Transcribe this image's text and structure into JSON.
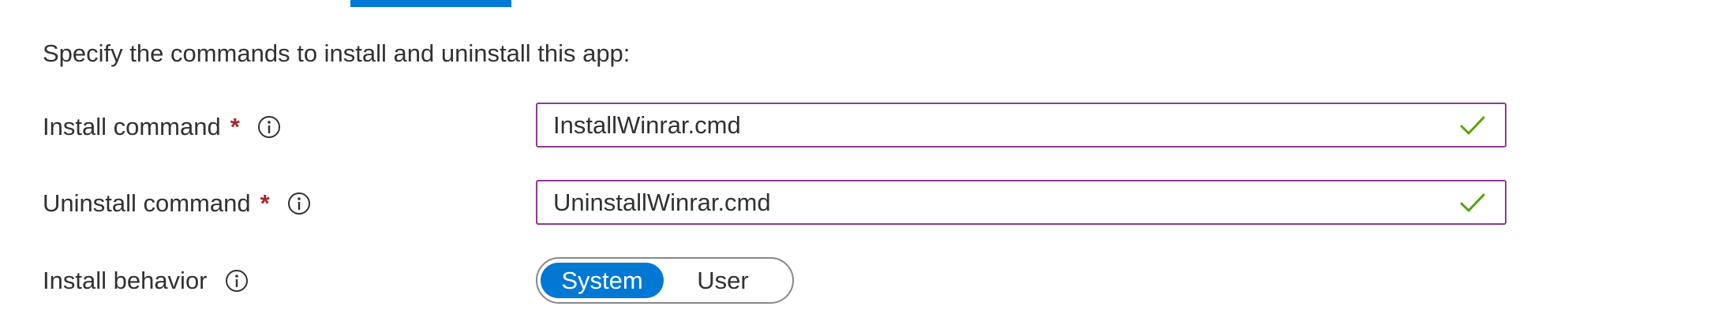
{
  "intro_text": "Specify the commands to install and uninstall this app:",
  "install_command": {
    "label": "Install command",
    "required_marker": "*",
    "value": "InstallWinrar.cmd",
    "valid": true
  },
  "uninstall_command": {
    "label": "Uninstall command",
    "required_marker": "*",
    "value": "UninstallWinrar.cmd",
    "valid": true
  },
  "install_behavior": {
    "label": "Install behavior",
    "options": [
      "System",
      "User"
    ],
    "selected": "System"
  },
  "colors": {
    "accent": "#0078d4",
    "required": "#a4262c",
    "field_border": "#8a3c8f",
    "valid_check": "#57a300"
  },
  "icons": {
    "info": "info-icon",
    "check": "check-icon"
  }
}
